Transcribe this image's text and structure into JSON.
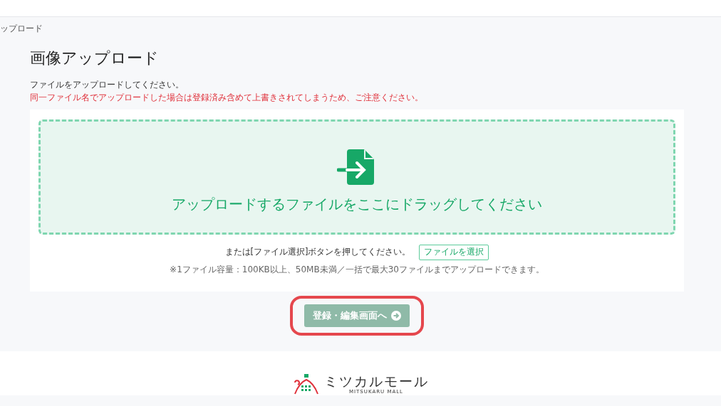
{
  "breadcrumb": "ップロード",
  "title": "画像アップロード",
  "intro": "ファイルをアップロードしてください。",
  "warning": "同一ファイル名でアップロードした場合は登録済み含めて上書きされてしまうため、ご注意ください。",
  "dropzone": {
    "text": "アップロードするファイルをここにドラッグしてください"
  },
  "select_hint": "または[ファイル選択]ボタンを押してください。",
  "select_button": "ファイルを選択",
  "note": "※1ファイル容量：100KB以上、50MB未満／一括で最大30ファイルまでアップロードできます。",
  "next_button": {
    "label": "登録・編集画面へ",
    "disabled": true,
    "highlighted": true
  },
  "footer": {
    "logo_text": "ミツカルモール",
    "logo_sub": "MITSUKARU MALL"
  }
}
